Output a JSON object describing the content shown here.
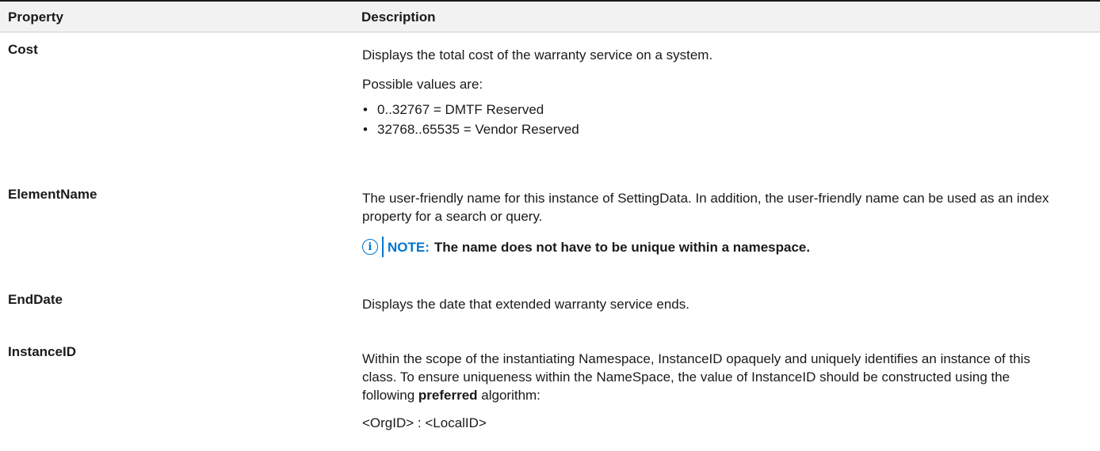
{
  "header": {
    "property": "Property",
    "description": "Description"
  },
  "rows": [
    {
      "property": "Cost",
      "description": "Displays the total cost of the warranty service on a system.",
      "values_intro": "Possible values are:",
      "values": [
        "0..32767 = DMTF Reserved",
        "32768..65535 = Vendor Reserved"
      ]
    },
    {
      "property": "ElementName",
      "description": "The user-friendly name for this instance of SettingData. In addition, the user-friendly name can be used as an index property for a search or query.",
      "note_label": "NOTE:",
      "note_text": "The name does not have to be unique within a namespace."
    },
    {
      "property": "EndDate",
      "description": "Displays the date that extended warranty service ends."
    },
    {
      "property": "InstanceID",
      "description_before": "Within the scope of the instantiating Namespace, InstanceID opaquely and uniquely identifies an instance of this class. To ensure uniqueness within the NameSpace, the value of InstanceID should be constructed using the following",
      "description_bold": "preferred",
      "description_after": "algorithm:",
      "format": "<OrgID> : <LocalID>"
    }
  ],
  "icons": {
    "info": "info-icon",
    "bullet": "•"
  },
  "colors": {
    "note_accent": "#0076ce",
    "header_bg": "#f2f2f2"
  }
}
